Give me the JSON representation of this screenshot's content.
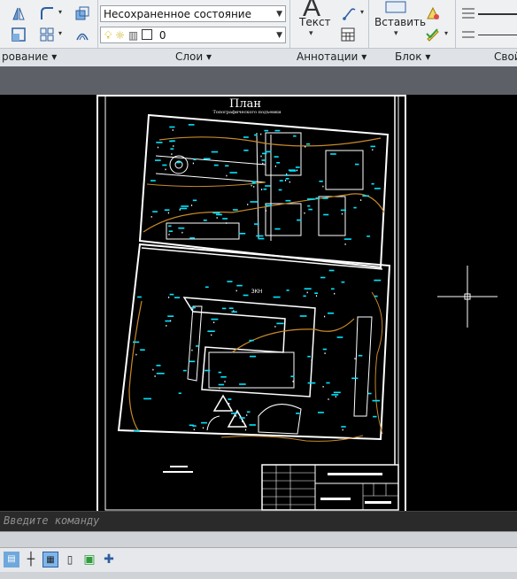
{
  "ribbon": {
    "panels": {
      "draw_modify": "рование",
      "layers": "Слои",
      "annotations": "Аннотации",
      "block": "Блок",
      "properties": "Свой"
    },
    "layer_state_combo": "Несохраненное состояние листа",
    "layer_combo_value": "0",
    "text_button_label": "Текст",
    "text_button_glyph": "A",
    "insert_button_label": "Вставить"
  },
  "drawing": {
    "title": "План",
    "subtitle": "Топографического подъемки",
    "zone_label": "ЗКН",
    "accent_cyan": "#00e5ff",
    "contour_color": "#c8892a",
    "line_color": "#ffffff"
  },
  "command_line": {
    "placeholder": "Введите команду"
  }
}
